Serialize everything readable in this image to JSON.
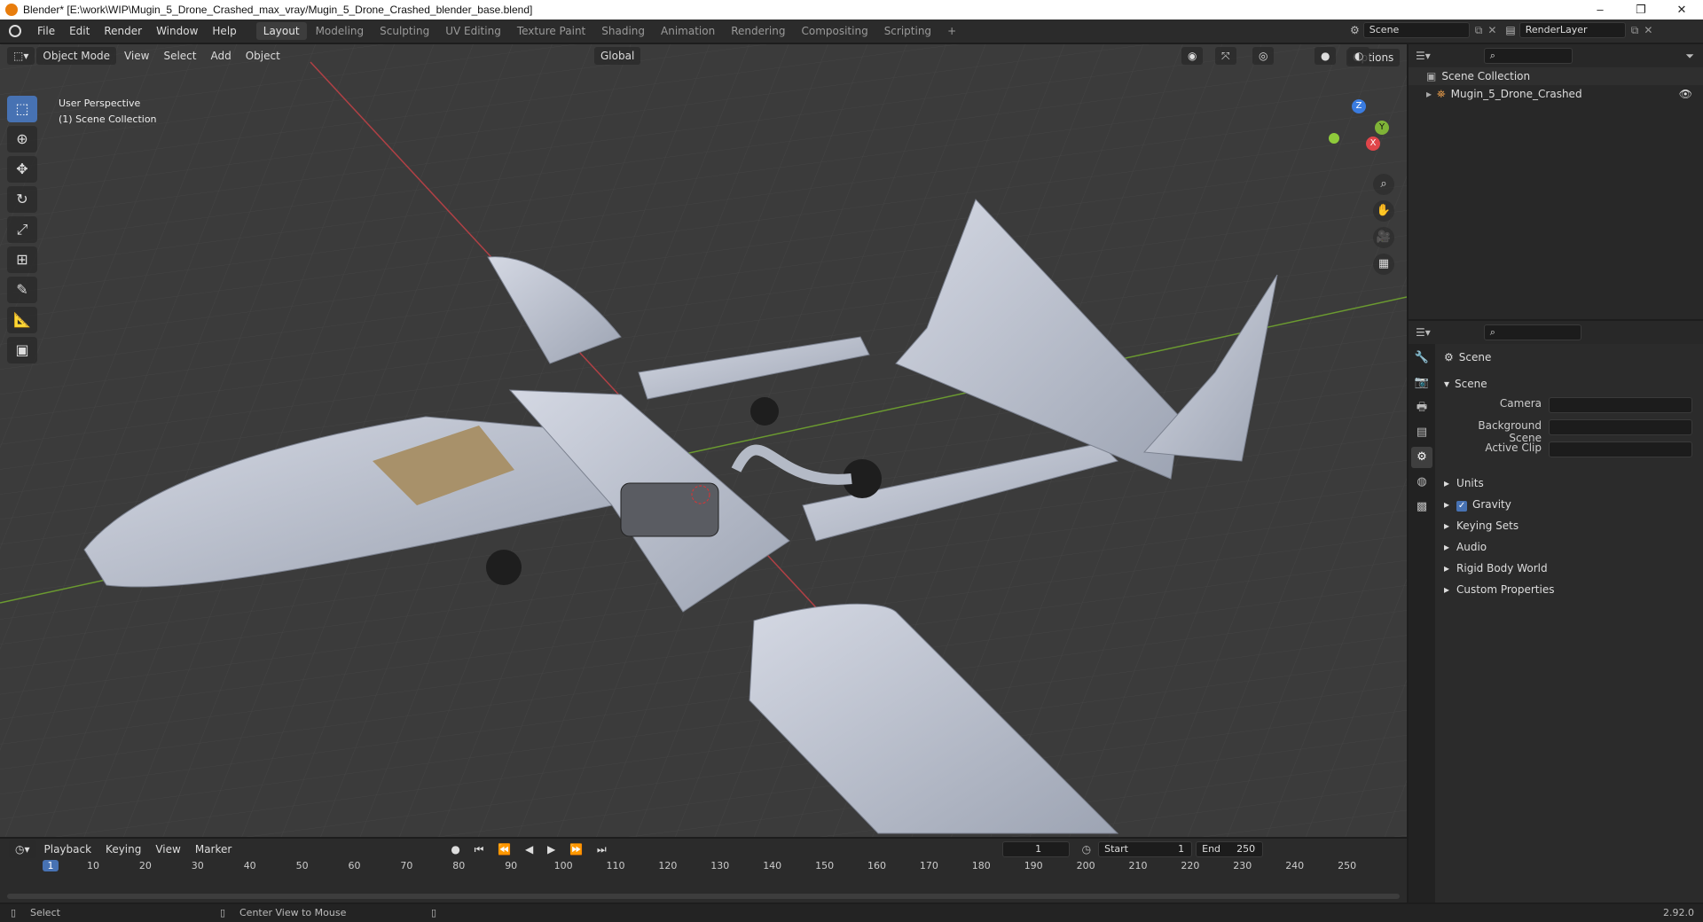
{
  "window": {
    "title": "Blender* [E:\\work\\WIP\\Mugin_5_Drone_Crashed_max_vray/Mugin_5_Drone_Crashed_blender_base.blend]",
    "controls": [
      "–",
      "❐",
      "✕"
    ]
  },
  "menu": [
    "File",
    "Edit",
    "Render",
    "Window",
    "Help"
  ],
  "workspaces": [
    "Layout",
    "Modeling",
    "Sculpting",
    "UV Editing",
    "Texture Paint",
    "Shading",
    "Animation",
    "Rendering",
    "Compositing",
    "Scripting",
    "+"
  ],
  "active_workspace": "Layout",
  "scene_selector": "Scene",
  "view_layer": "RenderLayer",
  "viewport": {
    "mode": "Object Mode",
    "menus": [
      "View",
      "Select",
      "Add",
      "Object"
    ],
    "orientation": "Global",
    "options_label": "Options",
    "overlay_lines": [
      "User Perspective",
      "(1) Scene Collection"
    ],
    "gizmo_axes": [
      "Z",
      "Y",
      "X"
    ],
    "tools": [
      "select-box",
      "cursor",
      "move",
      "rotate",
      "scale",
      "transform",
      "annotate",
      "measure",
      "add-cube"
    ]
  },
  "outliner": {
    "root": "Scene Collection",
    "items": [
      {
        "label": "Mugin_5_Drone_Crashed",
        "visible": true
      }
    ]
  },
  "properties": {
    "context_title": "Scene",
    "panel": "Scene",
    "fields": [
      {
        "label": "Camera",
        "value": ""
      },
      {
        "label": "Background Scene",
        "value": ""
      },
      {
        "label": "Active Clip",
        "value": ""
      }
    ],
    "subpanels": [
      {
        "label": "Units",
        "checkbox": false
      },
      {
        "label": "Gravity",
        "checkbox": true
      },
      {
        "label": "Keying Sets",
        "checkbox": false
      },
      {
        "label": "Audio",
        "checkbox": false
      },
      {
        "label": "Rigid Body World",
        "checkbox": false
      },
      {
        "label": "Custom Properties",
        "checkbox": false
      }
    ]
  },
  "timeline": {
    "menus": [
      "Playback",
      "Keying",
      "View",
      "Marker"
    ],
    "current_frame": "1",
    "start_label": "Start",
    "start": "1",
    "end_label": "End",
    "end": "250",
    "ruler": [
      "1",
      "10",
      "20",
      "30",
      "40",
      "50",
      "60",
      "70",
      "80",
      "90",
      "100",
      "110",
      "120",
      "130",
      "140",
      "150",
      "160",
      "170",
      "180",
      "190",
      "200",
      "210",
      "220",
      "230",
      "240",
      "250"
    ]
  },
  "status": {
    "left": "Select",
    "middle": "Center View to Mouse",
    "version": "2.92.0"
  },
  "colors": {
    "accent": "#4772b3",
    "x_axis": "#e0454a",
    "y_axis": "#7fb337",
    "z_axis": "#3a7ce0"
  }
}
